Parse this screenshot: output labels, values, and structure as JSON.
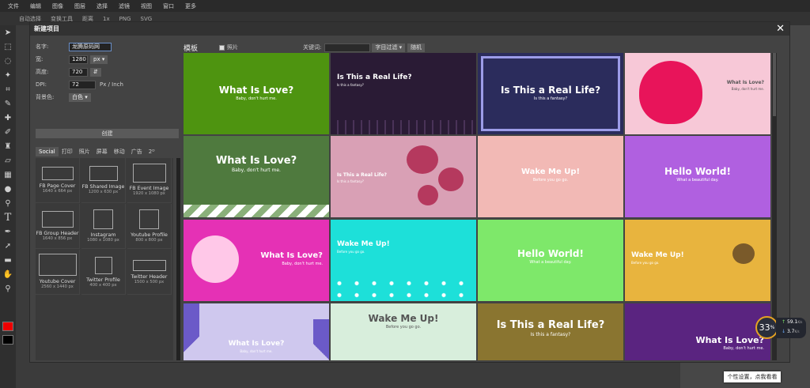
{
  "menu": [
    "文件",
    "编辑",
    "图像",
    "图层",
    "选择",
    "滤镜",
    "视图",
    "窗口",
    "更多"
  ],
  "optbar": [
    "自动选择",
    "变换工具",
    "距离",
    "1x",
    "PNG",
    "SVG"
  ],
  "dialog": {
    "title": "新建项目",
    "fields": {
      "name_label": "名字:",
      "name_value": "龙腾原码网",
      "width_label": "宽:",
      "width_value": "1280",
      "width_unit": "px",
      "height_label": "高度:",
      "height_value": "720",
      "dpi_label": "DPI:",
      "dpi_value": "72",
      "dpi_unit": "Px / Inch",
      "bg_label": "背景色:",
      "bg_value": "白色"
    },
    "create_label": "创建",
    "tabs": [
      "Social",
      "打印",
      "照片",
      "屏幕",
      "移动",
      "广告",
      "2ᴰ"
    ],
    "presets": [
      {
        "name": "FB Page Cover",
        "size": "1640 x 664 px"
      },
      {
        "name": "FB Shared Image",
        "size": "1200 x 630 px"
      },
      {
        "name": "FB Event Image",
        "size": "1920 x 1080 px"
      },
      {
        "name": "FB Group Header",
        "size": "1640 x 856 px"
      },
      {
        "name": "Instagram",
        "size": "1080 x 1080 px"
      },
      {
        "name": "Youtube Profile",
        "size": "800 x 800 px"
      },
      {
        "name": "Youtube Cover",
        "size": "2560 x 1440 px"
      },
      {
        "name": "Twitter Profile",
        "size": "400 x 400 px"
      },
      {
        "name": "Twitter Header",
        "size": "1500 x 500 px"
      }
    ],
    "templates_title": "模板",
    "photos_label": "照片",
    "keyword_label": "关键词:",
    "filter_button": "字目过滤",
    "random_button": "随机",
    "templates": [
      {
        "title": "What Is Love?",
        "subtitle": "Baby, don't hurt me.",
        "bg": "#4e9410",
        "fg": "#ffffff"
      },
      {
        "title": "Is This a Real Life?",
        "subtitle": "Is this a fantasy?",
        "bg": "#2a1b35",
        "fg": "#ffffff"
      },
      {
        "title": "Is This a Real Life?",
        "subtitle": "Is this a fantasy?",
        "bg": "#2b2c5c",
        "fg": "#ffffff"
      },
      {
        "title": "What Is Love?",
        "subtitle": "Baby, don't hurt me.",
        "bg": "#f7c8d7",
        "fg": "#555555"
      },
      {
        "title": "What Is Love?",
        "subtitle": "Baby, don't hurt me.",
        "bg": "#4f7a3e",
        "fg": "#ffffff"
      },
      {
        "title": "Is This a Real Life?",
        "subtitle": "Is this a fantasy?",
        "bg": "#d9a0b5",
        "fg": "#ffffff"
      },
      {
        "title": "Wake Me Up!",
        "subtitle": "Before you go go.",
        "bg": "#f2b9b5",
        "fg": "#ffffff"
      },
      {
        "title": "Hello World!",
        "subtitle": "What a beautiful day.",
        "bg": "#b060e0",
        "fg": "#ffffff"
      },
      {
        "title": "What Is Love?",
        "subtitle": "Baby, don't hurt me.",
        "bg": "#e531b5",
        "fg": "#ffffff"
      },
      {
        "title": "Wake Me Up!",
        "subtitle": "Before you go go.",
        "bg": "#1de0d9",
        "fg": "#ffffff"
      },
      {
        "title": "Hello World!",
        "subtitle": "What a beautiful day.",
        "bg": "#7ee86a",
        "fg": "#ffffff"
      },
      {
        "title": "Wake Me Up!",
        "subtitle": "Before you go go.",
        "bg": "#e8b43e",
        "fg": "#ffffff"
      },
      {
        "title": "What Is Love?",
        "subtitle": "Baby, don't hurt me.",
        "bg": "#cfc8ee",
        "fg": "#ffffff"
      },
      {
        "title": "Wake Me Up!",
        "subtitle": "Before you go go.",
        "bg": "#d8eedc",
        "fg": "#555555"
      },
      {
        "title": "Is This a Real Life?",
        "subtitle": "Is this a fantasy?",
        "bg": "#8a7530",
        "fg": "#ffffff"
      },
      {
        "title": "What Is Love?",
        "subtitle": "Baby, don't hurt me.",
        "bg": "#5a2480",
        "fg": "#ffffff"
      }
    ]
  },
  "perf": {
    "percent": "33",
    "percent_unit": "%",
    "up": "59.1",
    "up_unit": "K/s",
    "down": "3.7",
    "down_unit": "K/s"
  },
  "tooltip": "个性设置，点我看看"
}
